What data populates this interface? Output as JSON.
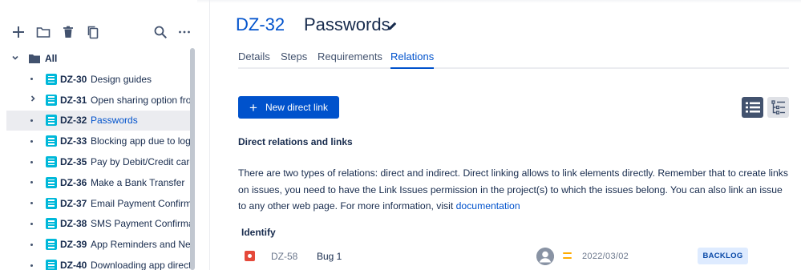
{
  "sidebar": {
    "toolbar": {
      "add": "add-icon",
      "folder": "folder-icon",
      "delete": "trash-icon",
      "copy": "copy-icon",
      "search": "search-icon",
      "more": "more-icon"
    },
    "root": {
      "label": "All",
      "expanded": true
    },
    "items": [
      {
        "key": "DZ-30",
        "title": "Design guides",
        "expandable": false,
        "selected": false
      },
      {
        "key": "DZ-31",
        "title": "Open sharing option from",
        "expandable": true,
        "selected": false
      },
      {
        "key": "DZ-32",
        "title": "Passwords",
        "expandable": false,
        "selected": true
      },
      {
        "key": "DZ-33",
        "title": "Blocking app due to login",
        "expandable": false,
        "selected": false
      },
      {
        "key": "DZ-35",
        "title": "Pay by Debit/Credit card",
        "expandable": false,
        "selected": false
      },
      {
        "key": "DZ-36",
        "title": "Make a Bank Transfer",
        "expandable": false,
        "selected": false
      },
      {
        "key": "DZ-37",
        "title": "Email Payment Confirmat",
        "expandable": false,
        "selected": false
      },
      {
        "key": "DZ-38",
        "title": "SMS Payment Confirmati",
        "expandable": false,
        "selected": false
      },
      {
        "key": "DZ-39",
        "title": "App Reminders and News",
        "expandable": false,
        "selected": false
      },
      {
        "key": "DZ-40",
        "title": "Downloading app directly",
        "expandable": false,
        "selected": false
      }
    ]
  },
  "issue": {
    "key": "DZ-32",
    "title": "Passwords"
  },
  "tabs": [
    {
      "label": "Details",
      "active": false
    },
    {
      "label": "Steps",
      "active": false
    },
    {
      "label": "Requirements",
      "active": false
    },
    {
      "label": "Relations",
      "active": true
    }
  ],
  "relations": {
    "new_link_label": "New direct link",
    "section_title": "Direct relations and links",
    "description": "There are two types of relations: direct and indirect. Direct linking allows to link elements directly. Remember that to create links on issues, you need to have the Link Issues permission in the project(s) to which the issues belong. You can also link an issue to any other web page. For more information, visit ",
    "description_link": "documentation",
    "groups": [
      {
        "title": "Identify",
        "links": [
          {
            "type_icon": "bug-icon",
            "key": "DZ-58",
            "title": "Bug 1",
            "priority": "medium",
            "date": "2022/03/02",
            "status": "BACKLOG"
          }
        ]
      }
    ]
  },
  "colors": {
    "accent": "#0052cc",
    "issue_type": "#00b8d9",
    "bug": "#e5493a",
    "priority_medium": "#ffab00",
    "status_bg": "#deebff"
  }
}
